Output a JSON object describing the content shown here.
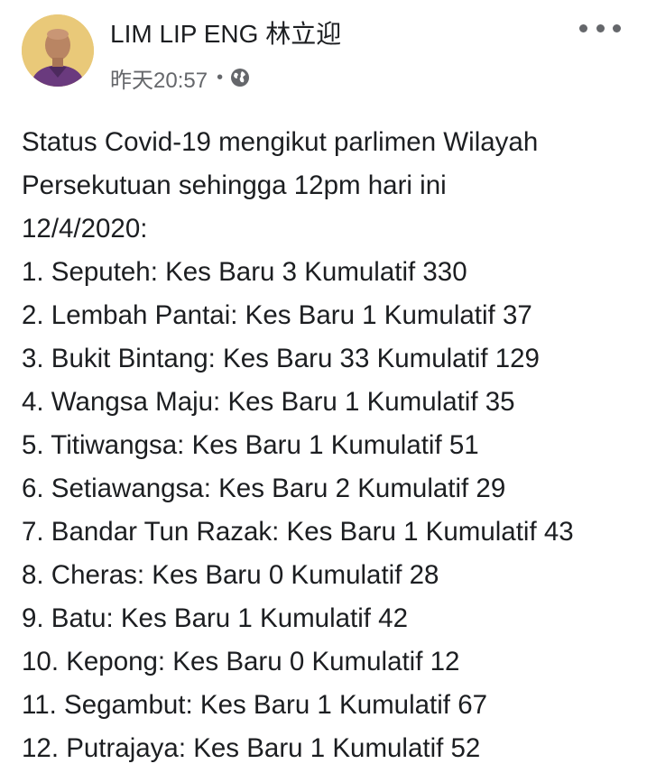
{
  "post": {
    "author_name": "LIM LIP ENG 林立迎",
    "timestamp": "昨天20:57",
    "separator": "•",
    "privacy_icon": "globe-icon",
    "more_icon": "more-options-icon",
    "body_lines": [
      "Status Covid-19 mengikut parlimen Wilayah",
      "Persekutuan sehingga 12pm hari ini",
      "12/4/2020:",
      "1. Seputeh: Kes Baru 3 Kumulatif 330",
      "2. Lembah Pantai: Kes Baru 1 Kumulatif 37",
      "3. Bukit Bintang: Kes Baru 33 Kumulatif 129",
      "4. Wangsa Maju: Kes Baru 1 Kumulatif 35",
      "5. Titiwangsa: Kes Baru 1 Kumulatif 51",
      "6. Setiawangsa: Kes Baru 2 Kumulatif 29",
      "7. Bandar Tun Razak: Kes Baru 1 Kumulatif 43",
      "8. Cheras: Kes Baru 0 Kumulatif 28",
      "9. Batu: Kes Baru 1 Kumulatif 42",
      "10. Kepong: Kes Baru 0 Kumulatif 12",
      "11. Segambut: Kes Baru 1 Kumulatif 67",
      "12. Putrajaya: Kes Baru 1 Kumulatif 52"
    ]
  }
}
